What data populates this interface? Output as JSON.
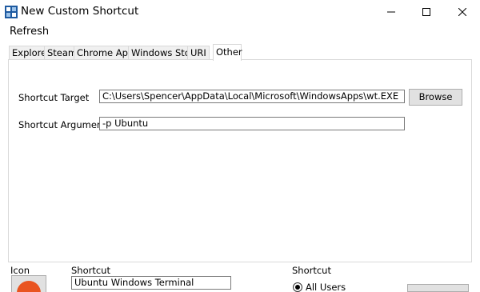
{
  "window": {
    "title": "New Custom Shortcut",
    "icon": "app-logo-icon",
    "controls": [
      "minimize-icon",
      "maximize-icon",
      "close-icon"
    ]
  },
  "menu": {
    "refresh": "Refresh"
  },
  "tabs": [
    {
      "label": "Explorer"
    },
    {
      "label": "Steam"
    },
    {
      "label": "Chrome Apps"
    },
    {
      "label": "Windows Store"
    },
    {
      "label": "URI"
    },
    {
      "label": "Other"
    }
  ],
  "active_tab": "Other",
  "other_tab": {
    "target_label": "Shortcut Target",
    "target_value": "C:\\Users\\Spencer\\AppData\\Local\\Microsoft\\WindowsApps\\wt.EXE",
    "browse_label": "Browse",
    "arguments_label": "Shortcut Arguments",
    "arguments_value": "-p Ubuntu"
  },
  "bottom": {
    "icon_label": "Icon",
    "shortcut_name_label": "Shortcut",
    "shortcut_name_value": "Ubuntu Windows Terminal",
    "shortcut_scope_label": "Shortcut",
    "all_users_label": "All Users"
  },
  "colors": {
    "ubuntu_orange": "#e95420",
    "app_icon_blue": "#1e5aa0"
  }
}
